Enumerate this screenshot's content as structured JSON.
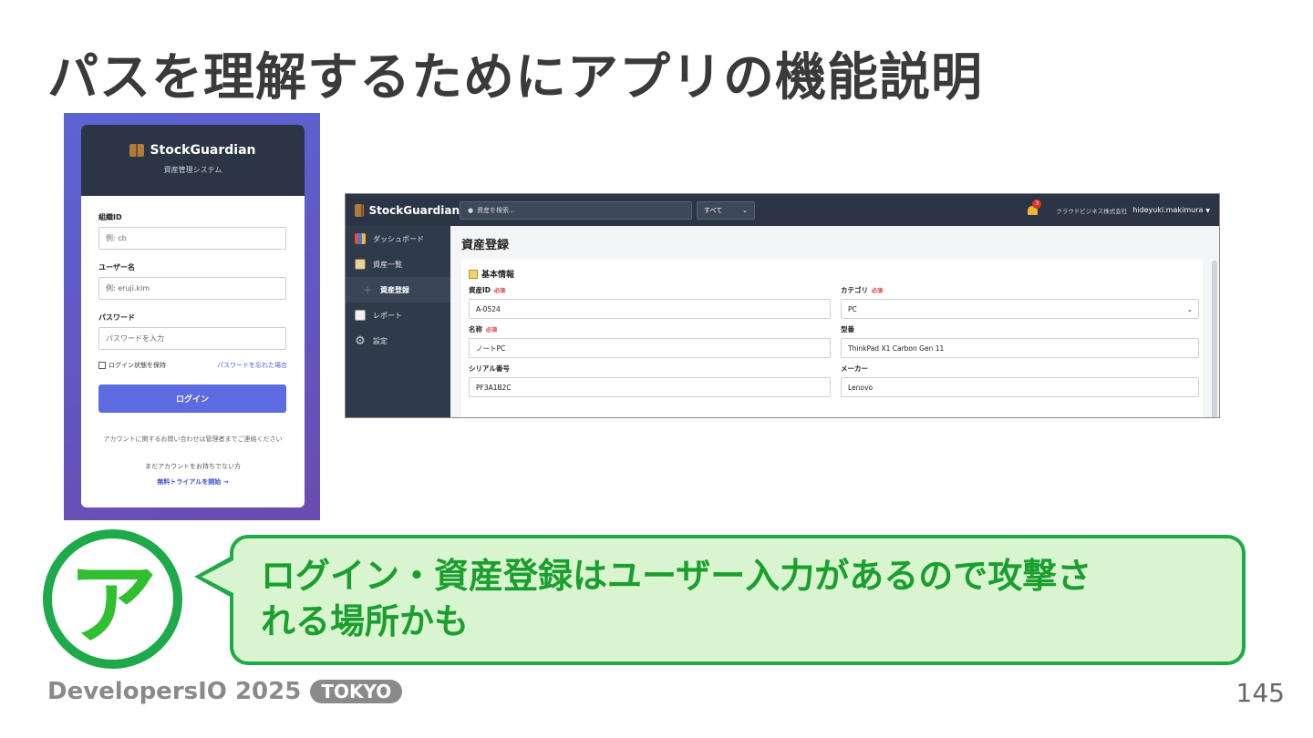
{
  "slide": {
    "title": "パスを理解するためにアプリの機能説明",
    "page_number": "145"
  },
  "login": {
    "brand": "StockGuardian",
    "subtitle": "資産管理システム",
    "org_label": "組織ID",
    "org_placeholder": "例: cb",
    "user_label": "ユーザー名",
    "user_placeholder": "例: eruji.kim",
    "password_label": "パスワード",
    "password_placeholder": "パスワードを入力",
    "remember_label": "ログイン状態を保持",
    "forgot_link": "パスワードを忘れた場合",
    "login_button": "ログイン",
    "contact_note": "アカウントに関するお問い合わせは管理者までご連絡ください",
    "no_account": "まだアカウントをお持ちでない方",
    "trial_link": "無料トライアルを開始 →"
  },
  "app": {
    "brand": "StockGuardian",
    "search_placeholder": "資産を検索...",
    "scope_selected": "すべて",
    "notification_count": "3",
    "company": "クラウドビジネス株式会社",
    "user": "hideyuki.makimura",
    "sidebar": [
      {
        "label": "ダッシュボード",
        "icon": "chart-icon"
      },
      {
        "label": "資産一覧",
        "icon": "clipboard-icon"
      },
      {
        "label": "資産登録",
        "icon": "plus-icon"
      },
      {
        "label": "レポート",
        "icon": "report-icon"
      },
      {
        "label": "設定",
        "icon": "gear-icon"
      }
    ],
    "page_title": "資産登録",
    "section_title": "基本情報",
    "required_tag": "必須",
    "fields": {
      "asset_id_label": "資産ID",
      "asset_id_value": "A-0524",
      "category_label": "カテゴリ",
      "category_value": "PC",
      "name_label": "名称",
      "name_value": "ノートPC",
      "model_label": "型番",
      "model_value": "ThinkPad X1 Carbon Gen 11",
      "serial_label": "シリアル番号",
      "serial_value": "PF3A1B2C",
      "maker_label": "メーカー",
      "maker_value": "Lenovo"
    }
  },
  "bubble": {
    "avatar_char": "ア",
    "line1": "ログイン・資産登録はユーザー入力があるので攻撃さ",
    "line2": "れる場所かも"
  },
  "footer": {
    "brand": "DevelopersIO 2025",
    "badge": "TOKYO"
  },
  "colors": {
    "accent_green": "#1eaa4a",
    "bubble_bg": "#d8f5cf",
    "app_header": "#2b3545",
    "login_button": "#5c6ce0"
  }
}
